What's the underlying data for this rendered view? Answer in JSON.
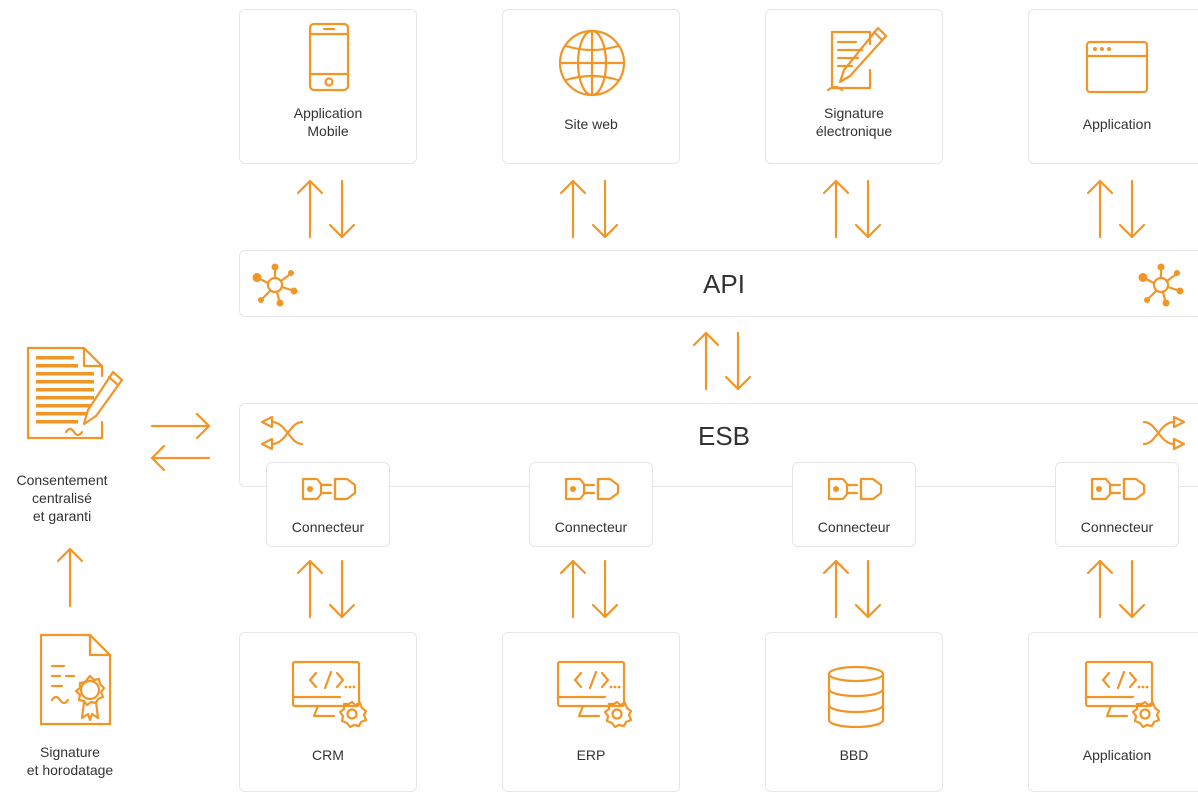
{
  "colors": {
    "accent": "#F29527",
    "border": "#e6e6e6",
    "text": "#333333"
  },
  "top_apps": [
    {
      "label": "Application\nMobile",
      "icon": "smartphone-icon"
    },
    {
      "label": "Site web",
      "icon": "globe-icon"
    },
    {
      "label": "Signature\nélectronique",
      "icon": "signature-pen-icon"
    },
    {
      "label": "Application",
      "icon": "browser-window-icon"
    }
  ],
  "api_bus": {
    "label": "API",
    "icon": "network-hub-icon"
  },
  "esb_bus": {
    "label": "ESB",
    "icon": "shuffle-icon"
  },
  "connectors": [
    {
      "label": "Connecteur",
      "icon": "plug-connector-icon"
    },
    {
      "label": "Connecteur",
      "icon": "plug-connector-icon"
    },
    {
      "label": "Connecteur",
      "icon": "plug-connector-icon"
    },
    {
      "label": "Connecteur",
      "icon": "plug-connector-icon"
    }
  ],
  "bottom_systems": [
    {
      "label": "CRM",
      "icon": "code-monitor-gear-icon"
    },
    {
      "label": "ERP",
      "icon": "code-monitor-gear-icon"
    },
    {
      "label": "BBD",
      "icon": "database-icon"
    },
    {
      "label": "Application",
      "icon": "code-monitor-gear-icon"
    }
  ],
  "consent": {
    "label": "Consentement\ncentralisé\net garanti",
    "icon": "signed-document-icon"
  },
  "timestamp": {
    "label": "Signature\net horodatage",
    "icon": "certificate-icon"
  }
}
